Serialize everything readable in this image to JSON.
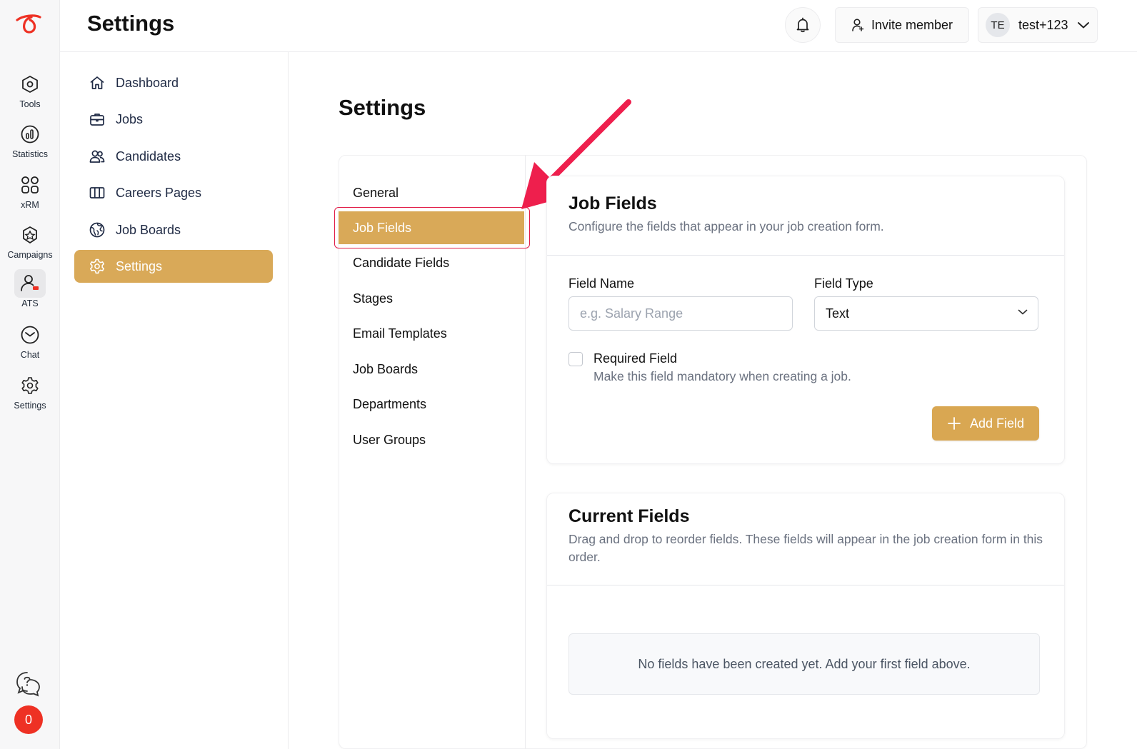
{
  "rail": {
    "items": [
      {
        "label": "Tools",
        "icon": "tools-icon"
      },
      {
        "label": "Statistics",
        "icon": "statistics-icon"
      },
      {
        "label": "xRM",
        "icon": "xrm-icon"
      },
      {
        "label": "Campaigns",
        "icon": "campaigns-icon"
      },
      {
        "label": "ATS",
        "icon": "ats-icon",
        "active": true
      },
      {
        "label": "Chat",
        "icon": "chat-icon"
      },
      {
        "label": "Settings",
        "icon": "settings-icon"
      }
    ],
    "notification_count": "0"
  },
  "header": {
    "title": "Settings",
    "invite_label": "Invite member",
    "user_initials": "TE",
    "user_name": "test+123"
  },
  "sidenav": {
    "items": [
      {
        "label": "Dashboard",
        "icon": "home-icon"
      },
      {
        "label": "Jobs",
        "icon": "briefcase-icon"
      },
      {
        "label": "Candidates",
        "icon": "users-icon"
      },
      {
        "label": "Careers Pages",
        "icon": "columns-icon"
      },
      {
        "label": "Job Boards",
        "icon": "globe-icon"
      },
      {
        "label": "Settings",
        "icon": "gear-icon",
        "active": true
      }
    ]
  },
  "content": {
    "title": "Settings",
    "subnav": [
      {
        "label": "General"
      },
      {
        "label": "Job Fields",
        "active": true
      },
      {
        "label": "Candidate Fields"
      },
      {
        "label": "Stages"
      },
      {
        "label": "Email Templates"
      },
      {
        "label": "Job Boards"
      },
      {
        "label": "Departments"
      },
      {
        "label": "User Groups"
      }
    ],
    "job_fields": {
      "title": "Job Fields",
      "description": "Configure the fields that appear in your job creation form.",
      "field_name_label": "Field Name",
      "field_name_placeholder": "e.g. Salary Range",
      "field_name_value": "",
      "field_type_label": "Field Type",
      "field_type_value": "Text",
      "required_label": "Required Field",
      "required_desc": "Make this field mandatory when creating a job.",
      "required_checked": false,
      "add_label": "Add Field"
    },
    "current_fields": {
      "title": "Current Fields",
      "description": "Drag and drop to reorder fields. These fields will appear in the job creation form in this order.",
      "empty_text": "No fields have been created yet. Add your first field above."
    }
  },
  "colors": {
    "accent": "#d9a958",
    "brand_red": "#ee3124",
    "annotation": "#e11d48"
  }
}
